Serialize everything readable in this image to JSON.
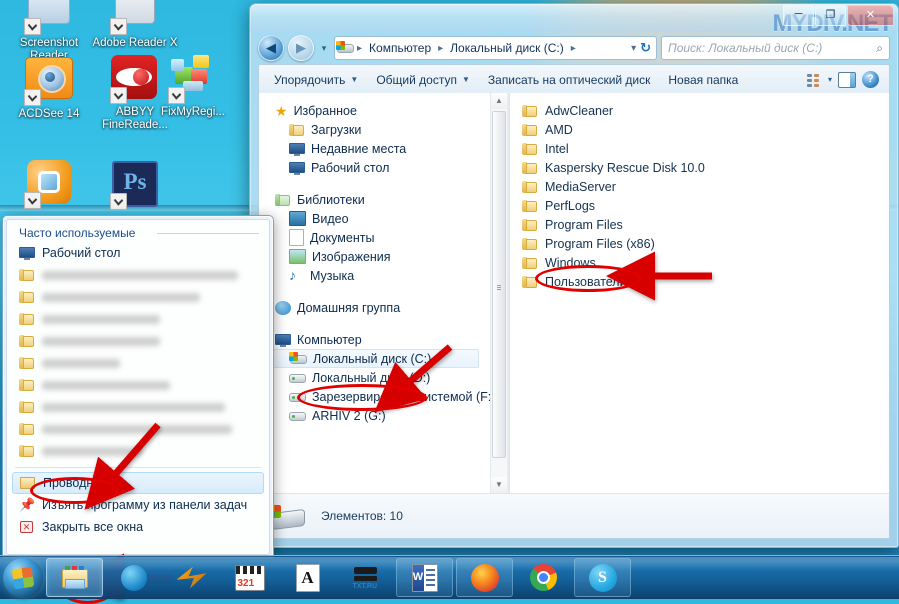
{
  "desktop": {
    "icons": [
      {
        "label": "Screenshot Reader",
        "icon": "screenshot-reader-icon"
      },
      {
        "label": "Adobe Reader X",
        "icon": "adobe-reader-icon"
      },
      {
        "label": "ACDSee 14",
        "icon": "acdsee-icon"
      },
      {
        "label": "ABBYY FineReade...",
        "icon": "abbyy-finereader-icon"
      },
      {
        "label": "FixMyRegi...",
        "icon": "fixmyregistry-icon"
      },
      {
        "label": "",
        "icon": "vmware-icon"
      },
      {
        "label": "",
        "icon": "photoshop-icon"
      }
    ]
  },
  "jumplist": {
    "header": "Часто используемые",
    "pinned_label": "Рабочий стол",
    "recent_widths": [
      196,
      158,
      118,
      118,
      78,
      128,
      183,
      190,
      100
    ],
    "tasks": [
      {
        "label": "Проводник",
        "icon": "explorer-icon",
        "highlighted": true
      },
      {
        "label": "Изъять программу из панели задач",
        "icon": "unpin-icon",
        "highlighted": false
      },
      {
        "label": "Закрыть все окна",
        "icon": "close-all-icon",
        "highlighted": false
      }
    ]
  },
  "explorer": {
    "watermark": "MYDIV.NET",
    "window_buttons": {
      "minimize": "─",
      "maximize": "❐",
      "close": "✕"
    },
    "address": {
      "crumbs": [
        "Компьютер",
        "Локальный диск (C:)"
      ],
      "separator": "▸",
      "dropdown": "▾",
      "refresh": "↻"
    },
    "search": {
      "placeholder": "Поиск: Локальный диск (C:)",
      "icon": "search-icon"
    },
    "toolbar": {
      "organize": "Упорядочить",
      "share": "Общий доступ",
      "burn": "Записать на оптический диск",
      "new_folder": "Новая папка",
      "view_icon": "view-mode-icon",
      "view_caret": "▾",
      "preview_icon": "preview-pane-icon",
      "help_icon": "?"
    },
    "navigation": {
      "groups": [
        {
          "title": "Избранное",
          "icon": "star-icon",
          "items": [
            {
              "label": "Загрузки",
              "icon": "downloads-icon"
            },
            {
              "label": "Недавние места",
              "icon": "recent-places-icon"
            },
            {
              "label": "Рабочий стол",
              "icon": "desktop-icon"
            }
          ]
        },
        {
          "title": "Библиотеки",
          "icon": "libraries-icon",
          "items": [
            {
              "label": "Видео",
              "icon": "video-icon"
            },
            {
              "label": "Документы",
              "icon": "documents-icon"
            },
            {
              "label": "Изображения",
              "icon": "pictures-icon"
            },
            {
              "label": "Музыка",
              "icon": "music-icon"
            }
          ]
        },
        {
          "title": "Домашняя группа",
          "icon": "homegroup-icon",
          "items": []
        },
        {
          "title": "Компьютер",
          "icon": "computer-icon",
          "items": [
            {
              "label": "Локальный диск (C:)",
              "icon": "windows-drive-icon",
              "selected": true
            },
            {
              "label": "Локальный диск (D:)",
              "icon": "drive-icon"
            },
            {
              "label": "Зарезервировано системой (F:)",
              "icon": "drive-icon"
            },
            {
              "label": "ARHIV 2 (G:)",
              "icon": "drive-icon"
            }
          ]
        }
      ]
    },
    "files": [
      {
        "name": "AdwCleaner",
        "icon": "folder-icon"
      },
      {
        "name": "AMD",
        "icon": "folder-icon"
      },
      {
        "name": "Intel",
        "icon": "folder-icon"
      },
      {
        "name": "Kaspersky Rescue Disk 10.0",
        "icon": "folder-icon"
      },
      {
        "name": "MediaServer",
        "icon": "folder-icon"
      },
      {
        "name": "PerfLogs",
        "icon": "folder-icon"
      },
      {
        "name": "Program Files",
        "icon": "folder-icon"
      },
      {
        "name": "Program Files (x86)",
        "icon": "folder-icon"
      },
      {
        "name": "Windows",
        "icon": "folder-icon",
        "highlighted": true
      },
      {
        "name": "Пользователи",
        "icon": "folder-icon"
      }
    ],
    "status": {
      "text": "Элементов: 10",
      "icon": "local-disk-icon"
    }
  },
  "taskbar": {
    "start_label": "start-orb",
    "buttons": [
      {
        "name": "explorer",
        "icon": "explorer-icon",
        "state": "active"
      },
      {
        "name": "ccleaner",
        "icon": "blue-c-icon",
        "state": "normal"
      },
      {
        "name": "winamp",
        "icon": "winamp-icon",
        "state": "normal"
      },
      {
        "name": "media-player-classic",
        "icon": "mpc-321-icon",
        "state": "normal"
      },
      {
        "name": "abbyy",
        "icon": "abbyy-a-icon",
        "state": "normal"
      },
      {
        "name": "txtru",
        "icon": "txt-ru-icon",
        "state": "normal"
      },
      {
        "name": "word",
        "icon": "word-icon",
        "state": "lite"
      },
      {
        "name": "firefox",
        "icon": "firefox-icon",
        "state": "lite"
      },
      {
        "name": "chrome",
        "icon": "chrome-icon",
        "state": "normal"
      },
      {
        "name": "skype",
        "icon": "skype-icon",
        "state": "lite"
      }
    ]
  },
  "annotations": {
    "colors": {
      "marker": "#e00000"
    },
    "ellipses": [
      "proovodnik-ellipse",
      "local-disk-c-ellipse",
      "windows-folder-ellipse",
      "taskbar-explorer-ellipse"
    ],
    "arrows": [
      "arrow-to-proovodnik",
      "arrow-to-local-disk-c",
      "arrow-to-windows-folder",
      "arrow-to-taskbar-explorer"
    ]
  }
}
